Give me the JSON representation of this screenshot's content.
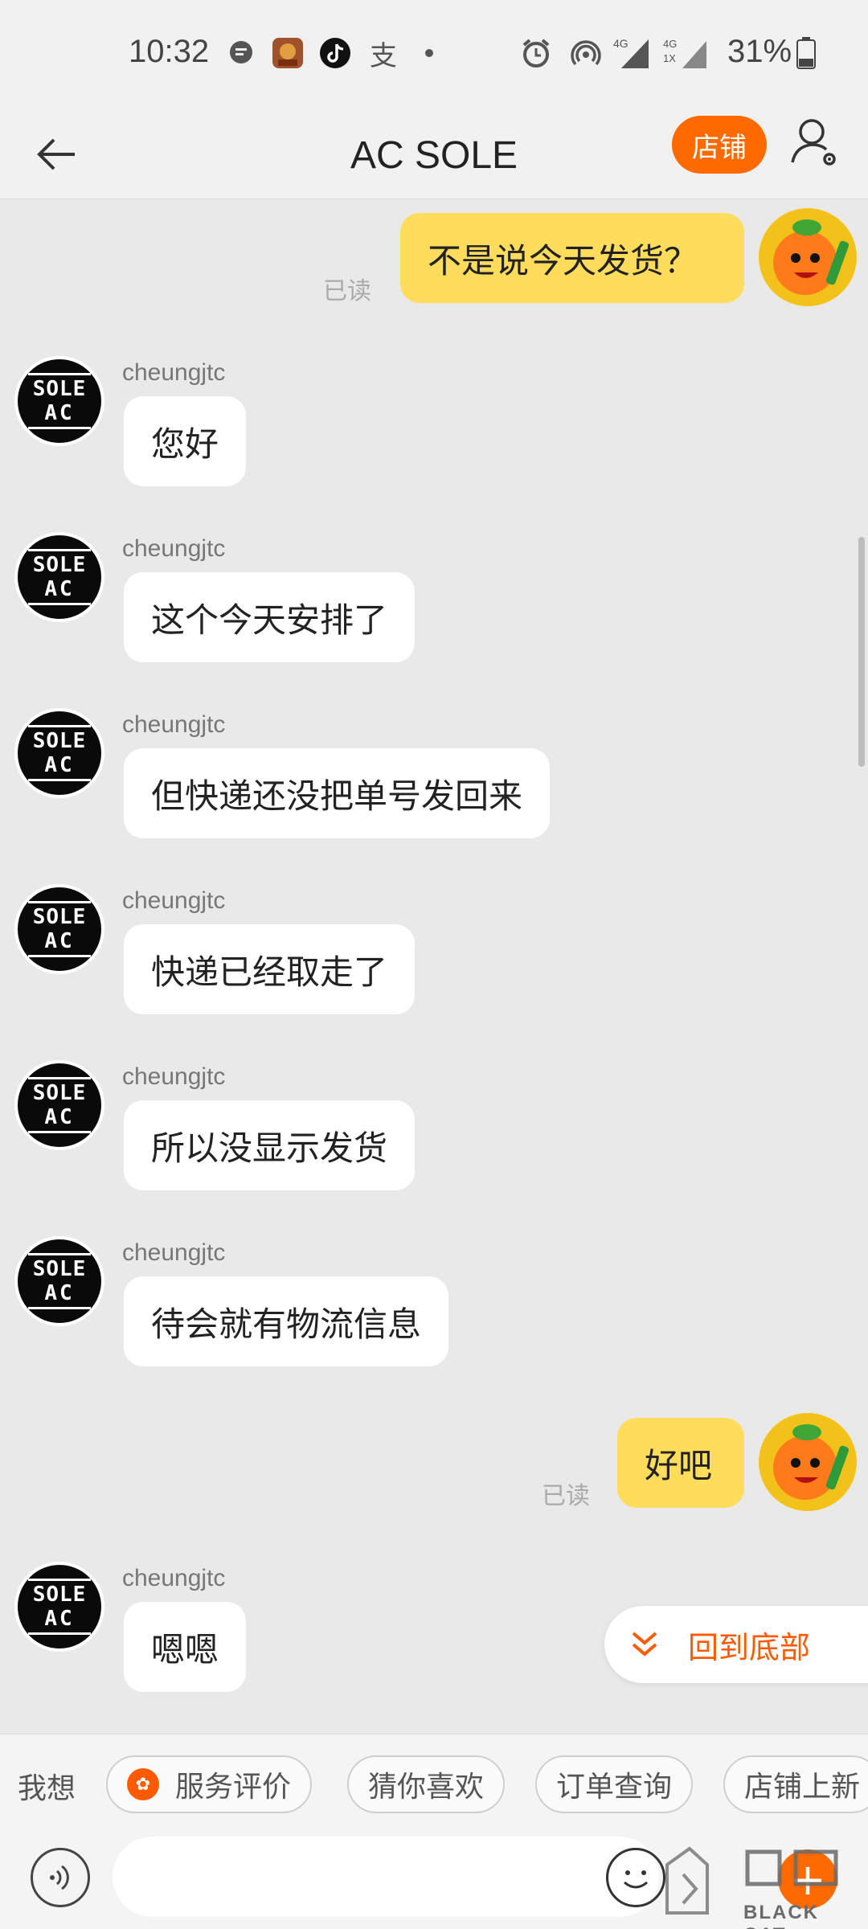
{
  "status_bar": {
    "time": "10:32",
    "battery": "31%",
    "network_1": "4G",
    "network_2": "4G 1X"
  },
  "nav": {
    "title": "AC SOLE",
    "shop_label": "店铺"
  },
  "store_avatar": {
    "line1": "SOLE",
    "line2": "AC"
  },
  "messages": [
    {
      "dir": "out",
      "text": "不是说今天发货？",
      "read": "已读"
    },
    {
      "dir": "in",
      "sender": "cheungjtc",
      "text": "您好"
    },
    {
      "dir": "in",
      "sender": "cheungjtc",
      "text": "这个今天安排了"
    },
    {
      "dir": "in",
      "sender": "cheungjtc",
      "text": "但快递还没把单号发回来"
    },
    {
      "dir": "in",
      "sender": "cheungjtc",
      "text": "快递已经取走了"
    },
    {
      "dir": "in",
      "sender": "cheungjtc",
      "text": "所以没显示发货"
    },
    {
      "dir": "in",
      "sender": "cheungjtc",
      "text": "待会就有物流信息"
    },
    {
      "dir": "out",
      "text": "好吧",
      "read": "已读"
    },
    {
      "dir": "in",
      "sender": "cheungjtc",
      "text": "嗯嗯"
    }
  ],
  "back_to_bottom": "回到底部",
  "quick_bar": {
    "prefix": "我想",
    "chips": [
      "服务评价",
      "猜你喜欢",
      "订单查询",
      "店铺上新"
    ]
  },
  "input": {
    "placeholder": ""
  },
  "watermark": {
    "text": "BLACK CAT"
  },
  "colors": {
    "accent": "#ff6a00",
    "out_bubble": "#ffdc5c",
    "in_bubble": "#ffffff",
    "background": "#e9e9e9"
  }
}
